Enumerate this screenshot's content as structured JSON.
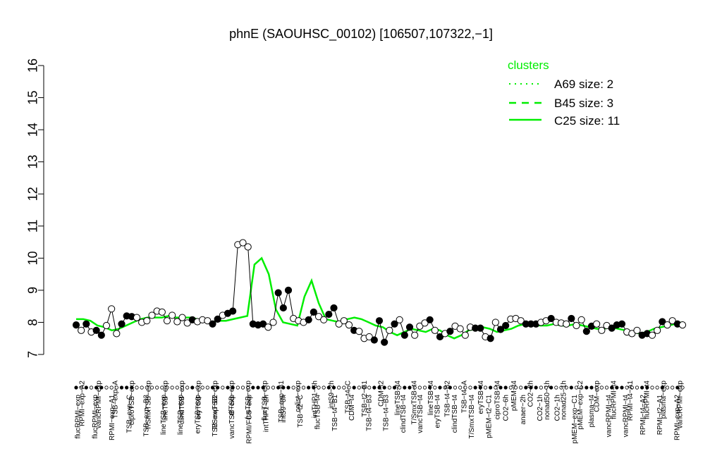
{
  "chart_data": {
    "type": "line",
    "title": "phnE (SAOUHSC_00102) [106507,107322,−1]",
    "xlabel": "",
    "ylabel": "",
    "ylim": [
      7,
      16
    ],
    "yticks": [
      "7",
      "8",
      "9",
      "10",
      "11",
      "12",
      "13",
      "14",
      "15",
      "16"
    ],
    "grid": false,
    "legend": {
      "title": "clusters",
      "position": "top-right",
      "color": "#00ee00",
      "entries": [
        {
          "label": "A69 size: 2",
          "style": "dotted"
        },
        {
          "label": "B45 size: 3",
          "style": "dashed"
        },
        {
          "label": "C25 size: 11",
          "style": "solid"
        }
      ]
    },
    "x_tick_labels_upper": [
      "RPMI−exp−A2",
      "vancRPMI−exp",
      "TSB−exp−A",
      "ciproTSB−exp",
      "T/SmxTSB−exp",
      "lineTSB−exp",
      "clindTSB−exp",
      "eryTSB−exp",
      "T/SmxTSB−exp",
      "rifTSB−exp",
      "fusTSB−exp",
      "flucTSB−exp",
      "TSB−exp−B1",
      "colist−exp",
      "intTHP1−6h",
      "intS9−2h",
      "TSB−t4−C",
      "TSB−t2−B1",
      "CDM−t2",
      "lineTSB−t4",
      "T/SmxTSB−t4",
      "lineTSB−t4",
      "TSB−t4−B2",
      "TSB−t4−A",
      "eryTSB−t4",
      "ciproTSB−t4",
      "pMEM−t4",
      "CO2−2h",
      "nonad50−1h",
      "nonad25−1h",
      "pMEM−exp−C2",
      "CDM−exp",
      "flucRPMI−t4",
      "RPMI−t4−A1",
      "flucRPMI−t4",
      "plasma−exp",
      "vancRPMI−exp"
    ],
    "x_tick_labels_lower": [
      "flucRPMI−exp",
      "flucRPMI−exp",
      "RPMI−exp−A1",
      "TSB−exp−C",
      "TSB−exp−B3",
      "lineTSB−exp",
      "lineTSB−exp",
      "eryTSB−exp",
      "TSB−exp−B2",
      "vancTSB−exp",
      "RPMI/FCS−exp",
      "intTHP1−2h",
      "intS9−6h",
      "TSB−t2−C",
      "flucTSB−t4",
      "TSB−t4−B1",
      "CDM−t4",
      "TSB−t4−B3",
      "TSB−t4−B3",
      "clindTSB−t4",
      "vancTSB−t4",
      "eryTSB−t4",
      "clindTSB−t4",
      "T/SmxTSB−t4",
      "pMEM−t2−C1",
      "CO2−6h",
      "anaer−2h",
      "CO2−1h",
      "CO2−1h",
      "pMEM−exp−C1",
      "plasma−t4",
      "vancRPMI−t4",
      "vancRPMI−t4",
      "RPMI−t4−A2",
      "RPMI−t2−A1",
      "RPMI−exp−A2"
    ],
    "points": [
      {
        "x": 1,
        "y": 7.92,
        "filled": true
      },
      {
        "x": 2,
        "y": 7.75,
        "filled": false
      },
      {
        "x": 3,
        "y": 7.95,
        "filled": true
      },
      {
        "x": 4,
        "y": 7.7,
        "filled": false
      },
      {
        "x": 5,
        "y": 7.75,
        "filled": true
      },
      {
        "x": 6,
        "y": 7.6,
        "filled": true
      },
      {
        "x": 7,
        "y": 7.9,
        "filled": false
      },
      {
        "x": 8,
        "y": 8.42,
        "filled": false
      },
      {
        "x": 9,
        "y": 7.65,
        "filled": false
      },
      {
        "x": 10,
        "y": 7.95,
        "filled": true
      },
      {
        "x": 11,
        "y": 8.2,
        "filled": true
      },
      {
        "x": 12,
        "y": 8.18,
        "filled": true
      },
      {
        "x": 13,
        "y": 8.15,
        "filled": false
      },
      {
        "x": 14,
        "y": 8.0,
        "filled": false
      },
      {
        "x": 15,
        "y": 8.05,
        "filled": false
      },
      {
        "x": 16,
        "y": 8.22,
        "filled": false
      },
      {
        "x": 17,
        "y": 8.35,
        "filled": false
      },
      {
        "x": 18,
        "y": 8.32,
        "filled": false
      },
      {
        "x": 19,
        "y": 8.05,
        "filled": false
      },
      {
        "x": 20,
        "y": 8.22,
        "filled": false
      },
      {
        "x": 21,
        "y": 8.02,
        "filled": false
      },
      {
        "x": 22,
        "y": 8.15,
        "filled": false
      },
      {
        "x": 23,
        "y": 7.98,
        "filled": false
      },
      {
        "x": 24,
        "y": 8.08,
        "filled": true
      },
      {
        "x": 25,
        "y": 8.02,
        "filled": false
      },
      {
        "x": 26,
        "y": 8.08,
        "filled": false
      },
      {
        "x": 27,
        "y": 8.05,
        "filled": false
      },
      {
        "x": 28,
        "y": 7.95,
        "filled": true
      },
      {
        "x": 29,
        "y": 8.1,
        "filled": true
      },
      {
        "x": 30,
        "y": 8.22,
        "filled": false
      },
      {
        "x": 31,
        "y": 8.28,
        "filled": true
      },
      {
        "x": 32,
        "y": 8.35,
        "filled": true
      },
      {
        "x": 33,
        "y": 10.42,
        "filled": false
      },
      {
        "x": 34,
        "y": 10.48,
        "filled": false
      },
      {
        "x": 35,
        "y": 10.35,
        "filled": false
      },
      {
        "x": 36,
        "y": 7.95,
        "filled": true
      },
      {
        "x": 37,
        "y": 7.92,
        "filled": true
      },
      {
        "x": 38,
        "y": 7.95,
        "filled": true
      },
      {
        "x": 39,
        "y": 7.85,
        "filled": false
      },
      {
        "x": 40,
        "y": 8.0,
        "filled": false
      },
      {
        "x": 41,
        "y": 8.92,
        "filled": true
      },
      {
        "x": 42,
        "y": 8.45,
        "filled": true
      },
      {
        "x": 43,
        "y": 9.0,
        "filled": true
      },
      {
        "x": 44,
        "y": 8.12,
        "filled": false
      },
      {
        "x": 45,
        "y": 8.05,
        "filled": false
      },
      {
        "x": 46,
        "y": 8.0,
        "filled": false
      },
      {
        "x": 47,
        "y": 8.08,
        "filled": true
      },
      {
        "x": 48,
        "y": 8.32,
        "filled": true
      },
      {
        "x": 49,
        "y": 8.18,
        "filled": false
      },
      {
        "x": 50,
        "y": 8.08,
        "filled": false
      },
      {
        "x": 51,
        "y": 8.25,
        "filled": true
      },
      {
        "x": 52,
        "y": 8.45,
        "filled": true
      },
      {
        "x": 53,
        "y": 7.95,
        "filled": false
      },
      {
        "x": 54,
        "y": 8.05,
        "filled": false
      },
      {
        "x": 55,
        "y": 7.92,
        "filled": false
      },
      {
        "x": 56,
        "y": 7.75,
        "filled": true
      },
      {
        "x": 57,
        "y": 7.72,
        "filled": false
      },
      {
        "x": 58,
        "y": 7.5,
        "filled": false
      },
      {
        "x": 59,
        "y": 7.55,
        "filled": false
      },
      {
        "x": 60,
        "y": 7.45,
        "filled": true
      },
      {
        "x": 61,
        "y": 8.05,
        "filled": true
      },
      {
        "x": 62,
        "y": 7.38,
        "filled": true
      },
      {
        "x": 63,
        "y": 7.75,
        "filled": false
      },
      {
        "x": 64,
        "y": 7.95,
        "filled": true
      },
      {
        "x": 65,
        "y": 8.08,
        "filled": false
      },
      {
        "x": 66,
        "y": 7.6,
        "filled": true
      },
      {
        "x": 67,
        "y": 7.85,
        "filled": true
      },
      {
        "x": 68,
        "y": 7.6,
        "filled": false
      },
      {
        "x": 69,
        "y": 7.88,
        "filled": false
      },
      {
        "x": 70,
        "y": 7.98,
        "filled": false
      },
      {
        "x": 71,
        "y": 8.08,
        "filled": true
      },
      {
        "x": 72,
        "y": 7.75,
        "filled": false
      },
      {
        "x": 73,
        "y": 7.55,
        "filled": true
      },
      {
        "x": 74,
        "y": 7.65,
        "filled": false
      },
      {
        "x": 75,
        "y": 7.72,
        "filled": true
      },
      {
        "x": 76,
        "y": 7.88,
        "filled": false
      },
      {
        "x": 77,
        "y": 7.8,
        "filled": false
      },
      {
        "x": 78,
        "y": 7.6,
        "filled": false
      },
      {
        "x": 79,
        "y": 7.85,
        "filled": false
      },
      {
        "x": 80,
        "y": 7.82,
        "filled": true
      },
      {
        "x": 81,
        "y": 7.82,
        "filled": true
      },
      {
        "x": 82,
        "y": 7.55,
        "filled": false
      },
      {
        "x": 83,
        "y": 7.5,
        "filled": true
      },
      {
        "x": 84,
        "y": 8.0,
        "filled": false
      },
      {
        "x": 85,
        "y": 7.78,
        "filled": true
      },
      {
        "x": 86,
        "y": 7.9,
        "filled": true
      },
      {
        "x": 87,
        "y": 8.1,
        "filled": false
      },
      {
        "x": 88,
        "y": 8.12,
        "filled": false
      },
      {
        "x": 89,
        "y": 8.05,
        "filled": false
      },
      {
        "x": 90,
        "y": 7.95,
        "filled": true
      },
      {
        "x": 91,
        "y": 7.95,
        "filled": true
      },
      {
        "x": 92,
        "y": 7.95,
        "filled": true
      },
      {
        "x": 93,
        "y": 8.0,
        "filled": false
      },
      {
        "x": 94,
        "y": 8.05,
        "filled": false
      },
      {
        "x": 95,
        "y": 8.12,
        "filled": true
      },
      {
        "x": 96,
        "y": 8.0,
        "filled": false
      },
      {
        "x": 97,
        "y": 7.98,
        "filled": false
      },
      {
        "x": 98,
        "y": 7.95,
        "filled": false
      },
      {
        "x": 99,
        "y": 8.12,
        "filled": true
      },
      {
        "x": 100,
        "y": 7.9,
        "filled": false
      },
      {
        "x": 101,
        "y": 8.08,
        "filled": false
      },
      {
        "x": 102,
        "y": 7.72,
        "filled": true
      },
      {
        "x": 103,
        "y": 7.88,
        "filled": true
      },
      {
        "x": 104,
        "y": 7.95,
        "filled": false
      },
      {
        "x": 105,
        "y": 7.75,
        "filled": false
      },
      {
        "x": 106,
        "y": 7.9,
        "filled": false
      },
      {
        "x": 107,
        "y": 7.82,
        "filled": true
      },
      {
        "x": 108,
        "y": 7.92,
        "filled": true
      },
      {
        "x": 109,
        "y": 7.95,
        "filled": true
      },
      {
        "x": 110,
        "y": 7.7,
        "filled": false
      },
      {
        "x": 111,
        "y": 7.65,
        "filled": false
      },
      {
        "x": 112,
        "y": 7.75,
        "filled": false
      },
      {
        "x": 113,
        "y": 7.6,
        "filled": true
      },
      {
        "x": 114,
        "y": 7.65,
        "filled": true
      },
      {
        "x": 115,
        "y": 7.6,
        "filled": false
      },
      {
        "x": 116,
        "y": 7.75,
        "filled": false
      },
      {
        "x": 117,
        "y": 8.02,
        "filled": true
      },
      {
        "x": 118,
        "y": 7.92,
        "filled": false
      },
      {
        "x": 119,
        "y": 8.05,
        "filled": false
      },
      {
        "x": 120,
        "y": 7.95,
        "filled": true
      },
      {
        "x": 121,
        "y": 7.92,
        "filled": false
      }
    ],
    "cluster_line": [
      8.1,
      8.1,
      8.05,
      7.9,
      7.85,
      7.75,
      7.8,
      7.9,
      8.0,
      8.1,
      8.15,
      8.15,
      8.15,
      8.2,
      8.15,
      8.15,
      8.15,
      8.1,
      8.05,
      8.0,
      8.05,
      8.05,
      8.1,
      8.15,
      8.2,
      9.8,
      10.0,
      9.5,
      8.4,
      8.0,
      7.95,
      7.9,
      8.8,
      9.3,
      8.6,
      8.1,
      8.05,
      8.0,
      8.1,
      8.15,
      8.1,
      8.0,
      7.9,
      7.85,
      7.7,
      7.6,
      7.7,
      7.8,
      7.75,
      7.7,
      7.8,
      7.75,
      7.6,
      7.5,
      7.6,
      7.75,
      7.8,
      7.85,
      7.8,
      7.7,
      7.75,
      7.8,
      7.9,
      7.95,
      7.95,
      7.9,
      7.9,
      7.95,
      7.9,
      7.9,
      7.95,
      7.9,
      7.85,
      7.8,
      7.8,
      7.85,
      7.8,
      7.75,
      7.7,
      7.65,
      7.7,
      7.8,
      7.85,
      7.9,
      7.95,
      8.0
    ]
  }
}
